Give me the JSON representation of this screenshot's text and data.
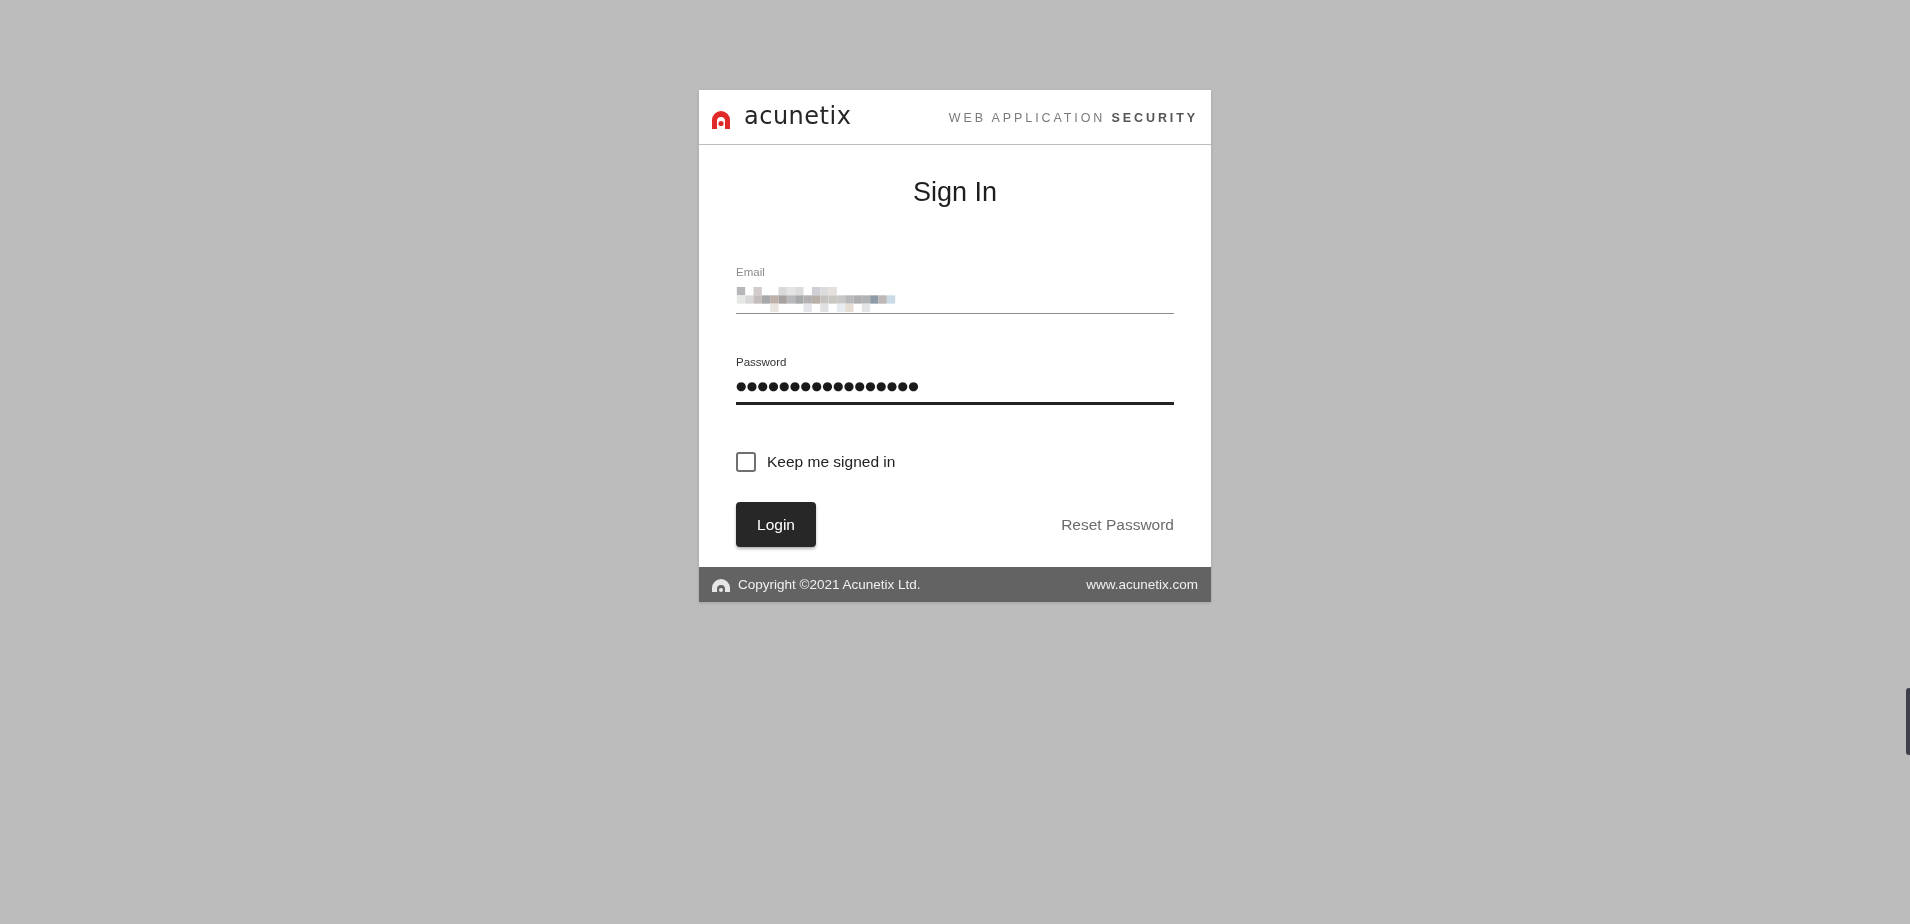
{
  "header": {
    "brand": "acunetix",
    "tagline": "WEB APPLICATION **SECURITY**"
  },
  "title": "Sign In",
  "fields": [
    {
      "label": "Email",
      "value_redacted": true,
      "focused": false
    },
    {
      "label": "Password",
      "value": "●●●●●●●●●●●●●●●●●",
      "focused": true
    }
  ],
  "keep_signed_in": {
    "label": "Keep me signed in",
    "checked": false
  },
  "login_button": "Login",
  "reset_link": "Reset Password",
  "footer": {
    "copyright": "Copyright ©2021 Acunetix Ltd.",
    "website": "www.acunetix.com"
  }
}
